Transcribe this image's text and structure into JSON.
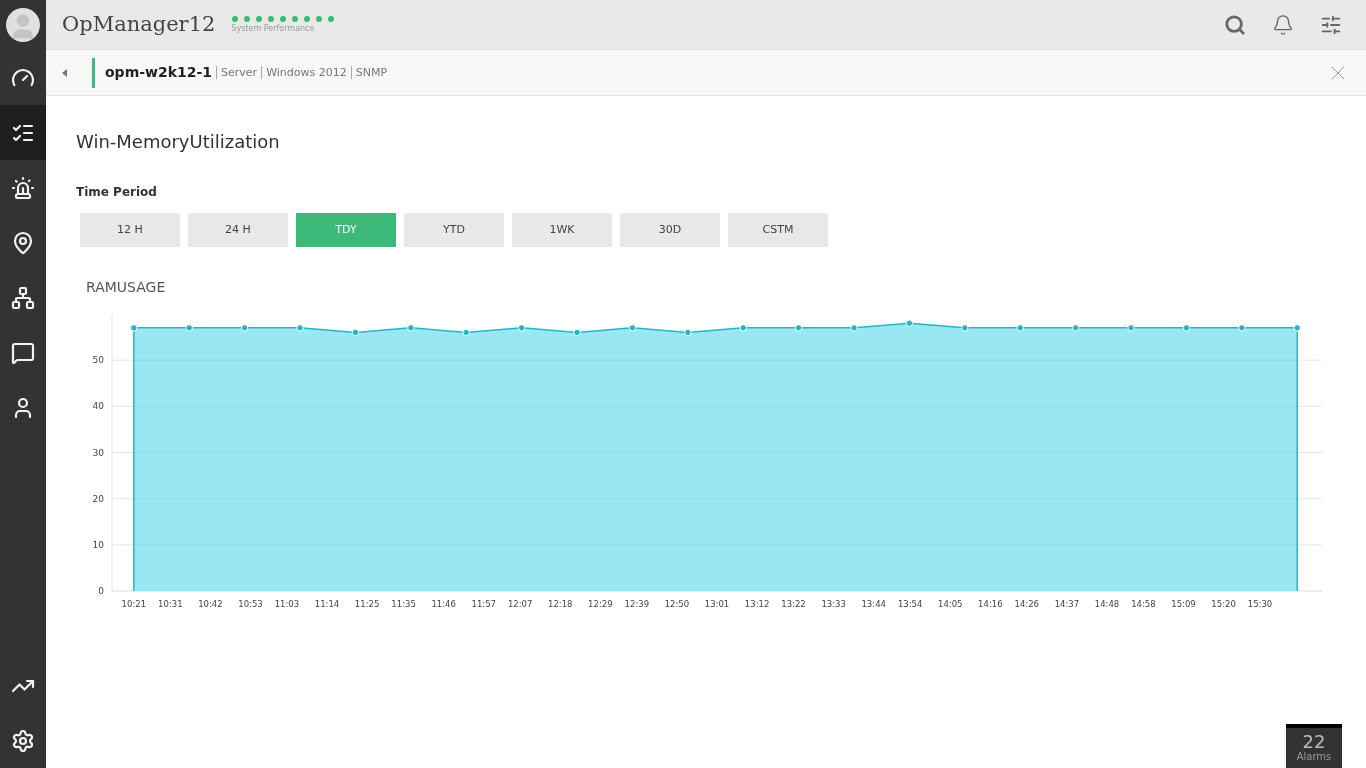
{
  "header": {
    "app_title": "OpManager12",
    "status_label": "System Performance"
  },
  "sidebar": {
    "items": [
      {
        "selected": false
      },
      {
        "selected": true
      },
      {
        "selected": false
      },
      {
        "selected": false
      },
      {
        "selected": false
      },
      {
        "selected": false
      },
      {
        "selected": false
      }
    ],
    "bottom_items": [
      {
        "selected": false
      },
      {
        "selected": false
      }
    ]
  },
  "device_bar": {
    "name": "opm-w2k12-1",
    "details": [
      "Server",
      "Windows 2012",
      "SNMP"
    ]
  },
  "page_title": "Win-MemoryUtilization",
  "time_period": {
    "label": "Time Period",
    "options": [
      {
        "label": "12 H",
        "selected": false
      },
      {
        "label": "24 H",
        "selected": false
      },
      {
        "label": "TDY",
        "selected": true
      },
      {
        "label": "YTD",
        "selected": false
      },
      {
        "label": "1WK",
        "selected": false
      },
      {
        "label": "30D",
        "selected": false
      },
      {
        "label": "CSTM",
        "selected": false
      }
    ]
  },
  "chart_data": {
    "type": "area",
    "title": "RAMUSAGE",
    "x": [
      621.0,
      636.2,
      651.4,
      666.6,
      681.8,
      697.0,
      712.2,
      727.4,
      742.6,
      757.8,
      773.0,
      788.2,
      803.4,
      818.6,
      833.8,
      849.0,
      864.2,
      879.4,
      894.6,
      909.8,
      925.0,
      940.2
    ],
    "grid": true,
    "series": [
      {
        "color": "#98e7f3",
        "values": [
          57,
          57,
          57,
          57,
          56,
          57,
          56,
          57,
          56,
          57,
          56,
          57,
          57,
          57,
          58,
          57,
          57,
          57,
          57,
          57,
          57,
          57
        ]
      }
    ],
    "xlim": [
      615,
      947
    ],
    "ylim": [
      0,
      60
    ],
    "yticks": [
      0,
      10,
      20,
      30,
      40,
      50
    ],
    "xticks": [
      {
        "value": 621,
        "label": "10:21"
      },
      {
        "value": 631,
        "label": "10:31"
      },
      {
        "value": 642,
        "label": "10:42"
      },
      {
        "value": 653,
        "label": "10:53"
      },
      {
        "value": 663,
        "label": "11:03"
      },
      {
        "value": 674,
        "label": "11:14"
      },
      {
        "value": 685,
        "label": "11:25"
      },
      {
        "value": 695,
        "label": "11:35"
      },
      {
        "value": 706,
        "label": "11:46"
      },
      {
        "value": 717,
        "label": "11:57"
      },
      {
        "value": 727,
        "label": "12:07"
      },
      {
        "value": 738,
        "label": "12:18"
      },
      {
        "value": 749,
        "label": "12:29"
      },
      {
        "value": 759,
        "label": "12:39"
      },
      {
        "value": 770,
        "label": "12:50"
      },
      {
        "value": 781,
        "label": "13:01"
      },
      {
        "value": 792,
        "label": "13:12"
      },
      {
        "value": 802,
        "label": "13:22"
      },
      {
        "value": 813,
        "label": "13:33"
      },
      {
        "value": 824,
        "label": "13:44"
      },
      {
        "value": 834,
        "label": "13:54"
      },
      {
        "value": 845,
        "label": "14:05"
      },
      {
        "value": 856,
        "label": "14:16"
      },
      {
        "value": 866,
        "label": "14:26"
      },
      {
        "value": 877,
        "label": "14:37"
      },
      {
        "value": 888,
        "label": "14:48"
      },
      {
        "value": 898,
        "label": "14:58"
      },
      {
        "value": 909,
        "label": "15:09"
      },
      {
        "value": 920,
        "label": "15:20"
      },
      {
        "value": 930,
        "label": "15:30"
      }
    ]
  },
  "alarms": {
    "count": "22",
    "label": "Alarms"
  }
}
